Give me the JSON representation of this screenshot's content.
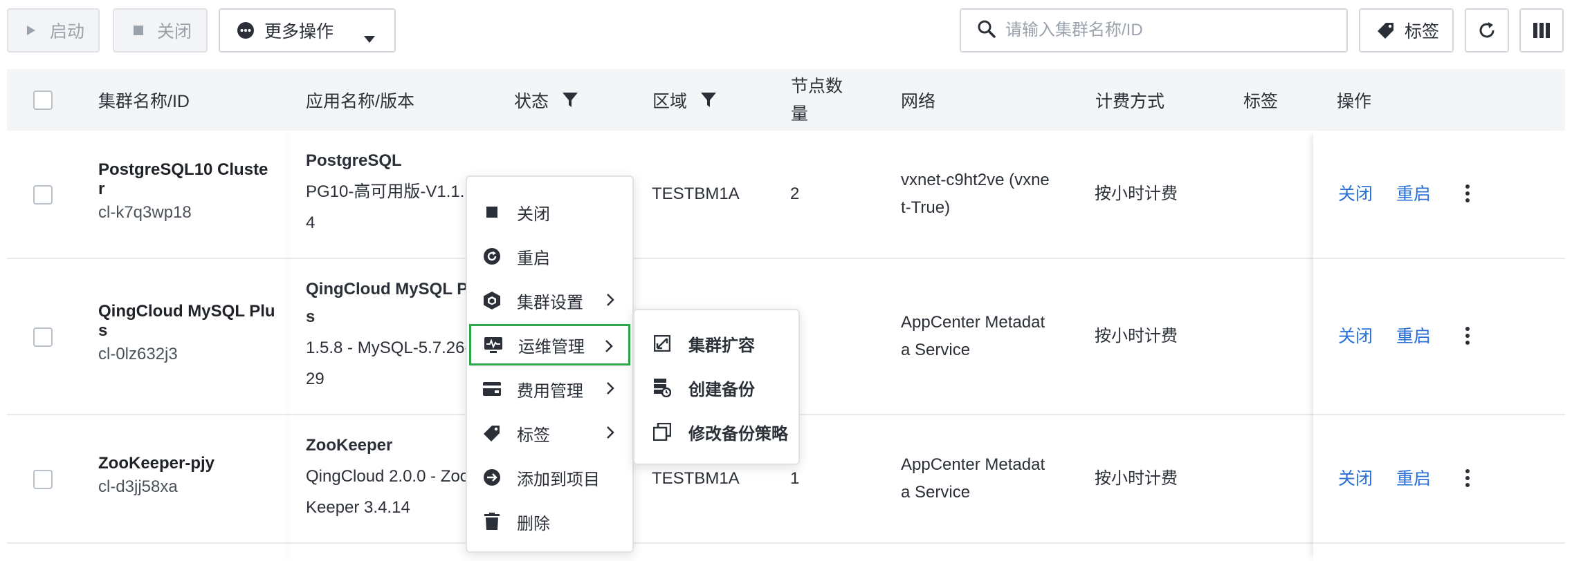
{
  "toolbar": {
    "start_label": "启动",
    "close_label": "关闭",
    "more_label": "更多操作",
    "search_placeholder": "请输入集群名称/ID",
    "tag_label": "标签"
  },
  "table": {
    "headers": {
      "name": "集群名称/ID",
      "app": "应用名称/版本",
      "status": "状态",
      "zone": "区域",
      "nodes_line1": "节点数",
      "nodes_line2": "量",
      "network": "网络",
      "billing": "计费方式",
      "tags": "标签",
      "actions": "操作"
    },
    "rows": [
      {
        "name_line1": "PostgreSQL10 Cluste",
        "name_line2": "r",
        "id": "cl-k7q3wp18",
        "app_name": "PostgreSQL",
        "app_ver_line1": "PG10-高可用版-V1.1.",
        "app_ver_line2": "4",
        "zone": "TESTBM1A",
        "nodes": "2",
        "network_line1": "vxnet-c9ht2ve (vxne",
        "network_line2": "t-True)",
        "billing": "按小时计费",
        "action_close": "关闭",
        "action_restart": "重启"
      },
      {
        "name_line1": "QingCloud MySQL Plu",
        "name_line2": "s",
        "id": "cl-0lz632j3",
        "app_name_line1": "QingCloud MySQL Plu",
        "app_name_line2": "s",
        "app_ver_line1": "1.5.8 - MySQL-5.7.26-",
        "app_ver_line2": "29",
        "network_line1": "AppCenter Metadat",
        "network_line2": "a Service",
        "billing": "按小时计费",
        "action_close": "关闭",
        "action_restart": "重启"
      },
      {
        "name_line1": "ZooKeeper-pjy",
        "id": "cl-d3jj58xa",
        "app_name": "ZooKeeper",
        "app_ver_line1": "QingCloud 2.0.0 - Zoo",
        "app_ver_line2": "Keeper 3.4.14",
        "zone": "TESTBM1A",
        "nodes": "1",
        "network_line1": "AppCenter Metadat",
        "network_line2": "a Service",
        "billing": "按小时计费",
        "action_close": "关闭",
        "action_restart": "重启"
      }
    ]
  },
  "context_menu": {
    "items": [
      {
        "label": "关闭",
        "icon": "stop-icon"
      },
      {
        "label": "重启",
        "icon": "restart-icon"
      },
      {
        "label": "集群设置",
        "icon": "cube-icon",
        "submenu": true
      },
      {
        "label": "运维管理",
        "icon": "monitor-icon",
        "submenu": true,
        "active": true
      },
      {
        "label": "费用管理",
        "icon": "wallet-icon",
        "submenu": true
      },
      {
        "label": "标签",
        "icon": "tag-icon",
        "submenu": true
      },
      {
        "label": "添加到项目",
        "icon": "arrow-circle-icon"
      },
      {
        "label": "删除",
        "icon": "trash-icon"
      }
    ]
  },
  "submenu": {
    "items": [
      {
        "label": "集群扩容",
        "icon": "scale-icon"
      },
      {
        "label": "创建备份",
        "icon": "backup-icon"
      },
      {
        "label": "修改备份策略",
        "icon": "copy-icon"
      }
    ]
  },
  "colors": {
    "link": "#2a6fd6",
    "active_outline": "#2ea84a",
    "header_bg": "#f3f5f7"
  }
}
